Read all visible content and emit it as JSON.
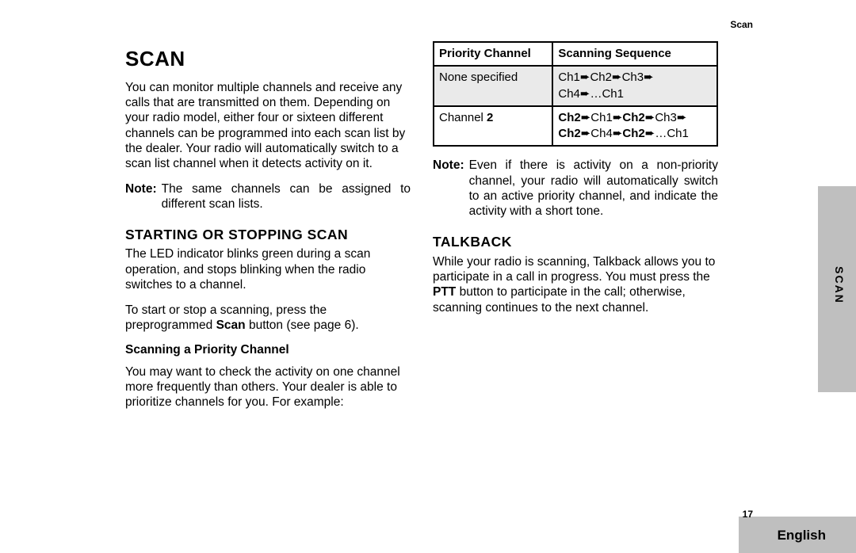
{
  "header": {
    "section": "Scan"
  },
  "title": "SCAN",
  "intro": "You can monitor multiple channels and receive any calls that are transmitted on them. Depending on your radio model, either four or sixteen different channels can be programmed into each scan list by the dealer. Your radio will automatically switch to a scan list channel when it detects activity on it.",
  "note1": {
    "label": "Note:",
    "text": "The same channels can be assigned to different scan lists."
  },
  "start_stop": {
    "heading": "STARTING OR STOPPING SCAN",
    "p1": "The LED indicator blinks green during a scan operation, and stops blinking when the radio switches to a channel.",
    "p2_pre": "To start or stop a scanning, press the preprogrammed ",
    "p2_bold": "Scan",
    "p2_post": " button (see page 6)."
  },
  "priority": {
    "heading": "Scanning a Priority Channel",
    "text": "You may want to check the activity on one channel more frequently than others. Your dealer is able to prioritize channels for you. For example:"
  },
  "table": {
    "h1": "Priority Channel",
    "h2": "Scanning Sequence",
    "r1c1": "None specified",
    "r1c2a": "Ch1",
    "r1c2b": "Ch2",
    "r1c2c": "Ch3",
    "r1c2d": "Ch4",
    "r1c2e": "…Ch1",
    "r2c1_pre": "Channel ",
    "r2c1_bold": "2",
    "r2c2_a": "Ch2",
    "r2c2_b": "Ch1",
    "r2c2_c": "Ch2",
    "r2c2_d": "Ch3",
    "r2c2_e": "Ch2",
    "r2c2_f": "Ch4",
    "r2c2_g": "Ch2",
    "r2c2_h": "…Ch1"
  },
  "note2": {
    "label": "Note:",
    "text": "Even if there is activity on a non-priority channel, your radio will automatically switch to an active priority channel, and indicate the activity with a short tone."
  },
  "talkback": {
    "heading": "TALKBACK",
    "p_pre": "While your radio is scanning, Talkback allows you to participate in a call in progress. You must press the ",
    "p_bold": "PTT",
    "p_post": " button to participate in the call; otherwise, scanning continues to the next channel."
  },
  "page_number": "17",
  "side_tab": "SCAN",
  "language": "English",
  "arrow": "➨"
}
